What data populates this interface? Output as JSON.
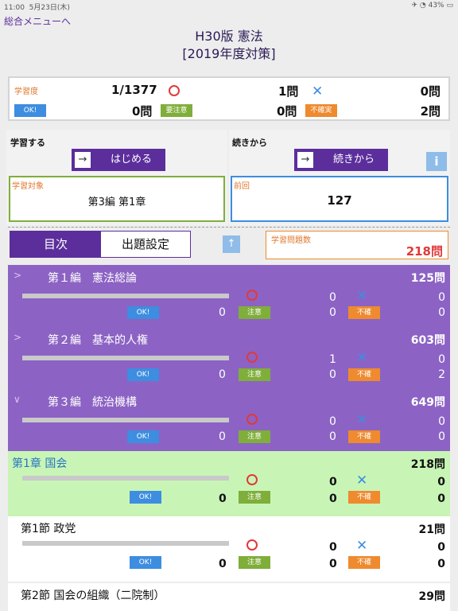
{
  "statusbar": {
    "time": "11:00",
    "date": "5月23日(木)",
    "battery": "43%"
  },
  "nav": {
    "back_label": "総合メニューへ"
  },
  "title": {
    "line1": "H30版 憲法",
    "line2": "[2019年度対策]"
  },
  "progress": {
    "label": "学習度",
    "ratio": "1/1377",
    "correct": "1問",
    "wrong": "0問",
    "ok_label": "OK!",
    "ok_count": "0問",
    "caution_label": "要注意",
    "caution_count": "0問",
    "unsure_label": "不確実",
    "unsure_count": "2問"
  },
  "study": {
    "label": "学習する",
    "start_label": "はじめる",
    "arrow": "→",
    "target_label": "学習対象",
    "target_value": "第3編 第1章"
  },
  "resume": {
    "label": "続きから",
    "button_label": "続きから",
    "arrow": "→",
    "info_label": "i",
    "prev_label": "前回",
    "prev_value": "127"
  },
  "tabs": {
    "toc": "目次",
    "settings": "出題設定"
  },
  "up_arrow": "↑",
  "qcount": {
    "label": "学習問題数",
    "value": "218問"
  },
  "chips": {
    "ok": "OK!",
    "caution": "注意",
    "unsure": "不確"
  },
  "marks": {
    "wrong": "✕"
  },
  "rows": [
    {
      "chev": ">",
      "name": "第１編　憲法総論",
      "count": "125問",
      "correct": "0",
      "wrong": "0",
      "ok": "0",
      "caution": "0",
      "unsure": "0"
    },
    {
      "chev": ">",
      "name": "第２編　基本的人権",
      "count": "603問",
      "correct": "1",
      "wrong": "0",
      "ok": "0",
      "caution": "0",
      "unsure": "2"
    },
    {
      "chev": "∨",
      "name": "第３編　統治機構",
      "count": "649問",
      "correct": "0",
      "wrong": "0",
      "ok": "0",
      "caution": "0",
      "unsure": "0"
    },
    {
      "chev": "",
      "name": "第1章 国会",
      "count": "218問",
      "correct": "0",
      "wrong": "0",
      "ok": "0",
      "caution": "0",
      "unsure": "0"
    },
    {
      "chev": "",
      "name": "第1節 政党",
      "count": "21問",
      "correct": "0",
      "wrong": "0",
      "ok": "0",
      "caution": "0",
      "unsure": "0"
    },
    {
      "chev": "",
      "name": "第2節 国会の組織（二院制）",
      "count": "29問",
      "correct": "",
      "wrong": "",
      "ok": "",
      "caution": "",
      "unsure": ""
    }
  ]
}
